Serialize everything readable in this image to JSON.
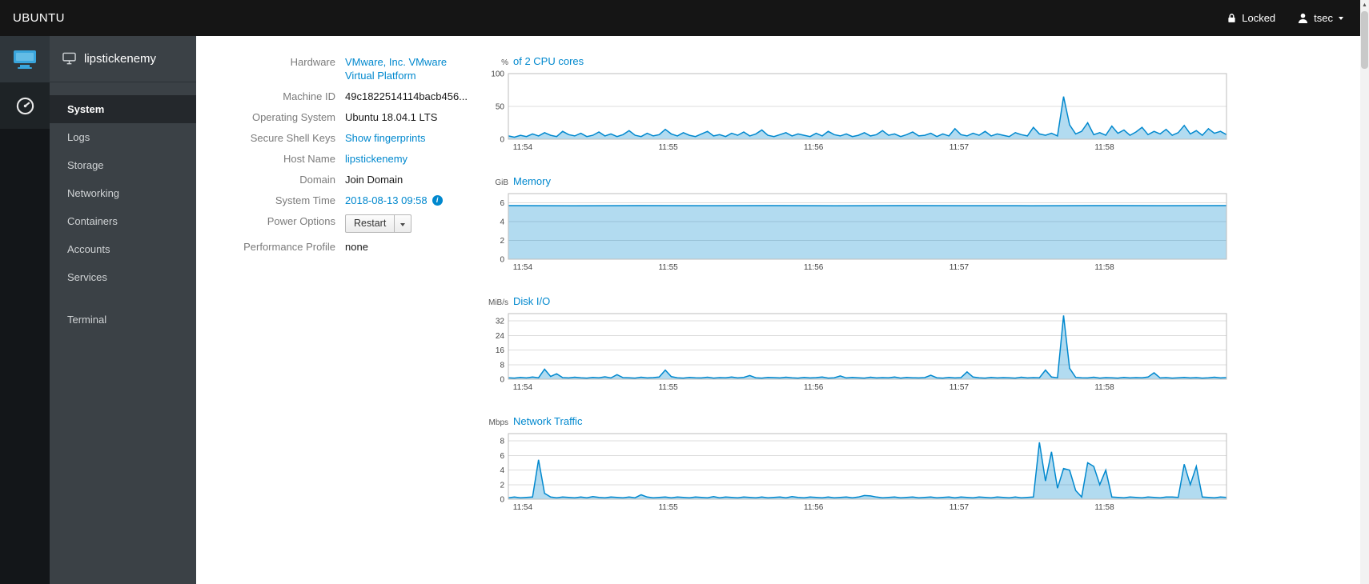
{
  "topbar": {
    "brand": "UBUNTU",
    "locked_label": "Locked",
    "user_label": "tsec"
  },
  "nav": {
    "host": "lipstickenemy",
    "items": [
      {
        "label": "System",
        "active": true
      },
      {
        "label": "Logs",
        "active": false
      },
      {
        "label": "Storage",
        "active": false
      },
      {
        "label": "Networking",
        "active": false
      },
      {
        "label": "Containers",
        "active": false
      },
      {
        "label": "Accounts",
        "active": false
      },
      {
        "label": "Services",
        "active": false
      }
    ],
    "secondary_items": [
      {
        "label": "Terminal",
        "active": false
      }
    ]
  },
  "details": {
    "rows": [
      {
        "label": "Hardware",
        "value": "VMware, Inc. VMware Virtual Platform",
        "type": "link"
      },
      {
        "label": "Machine ID",
        "value": "49c1822514114bacb456...",
        "type": "text"
      },
      {
        "label": "Operating System",
        "value": "Ubuntu 18.04.1 LTS",
        "type": "text"
      },
      {
        "label": "Secure Shell Keys",
        "value": "Show fingerprints",
        "type": "link"
      },
      {
        "label": "Host Name",
        "value": "lipstickenemy",
        "type": "link"
      },
      {
        "label": "Domain",
        "value": "Join Domain",
        "type": "action"
      },
      {
        "label": "System Time",
        "value": "2018-08-13 09:58",
        "type": "link",
        "info_icon": true
      },
      {
        "label": "Power Options",
        "value": "Restart",
        "type": "button_dropdown"
      },
      {
        "label": "Performance Profile",
        "value": "none",
        "type": "text"
      }
    ]
  },
  "chart_data": [
    {
      "type": "area",
      "unit": "%",
      "title": "of 2 CPU cores",
      "ylim": [
        0,
        100
      ],
      "yticks": [
        0,
        50,
        100
      ],
      "xtick_labels": [
        "11:54",
        "11:55",
        "11:56",
        "11:57",
        "11:58"
      ],
      "xtick_fracs": [
        0.02,
        0.2225,
        0.425,
        0.6275,
        0.83
      ],
      "values": [
        5,
        3,
        6,
        4,
        8,
        5,
        10,
        6,
        4,
        12,
        7,
        5,
        9,
        4,
        6,
        11,
        5,
        8,
        4,
        7,
        13,
        6,
        4,
        9,
        5,
        7,
        15,
        8,
        5,
        10,
        6,
        4,
        8,
        12,
        5,
        7,
        4,
        9,
        6,
        11,
        5,
        8,
        14,
        6,
        4,
        7,
        10,
        5,
        8,
        6,
        4,
        9,
        5,
        12,
        7,
        5,
        8,
        4,
        6,
        10,
        5,
        7,
        13,
        6,
        8,
        4,
        7,
        11,
        5,
        6,
        9,
        4,
        8,
        5,
        16,
        7,
        5,
        9,
        6,
        12,
        5,
        8,
        6,
        4,
        10,
        7,
        5,
        18,
        8,
        6,
        9,
        5,
        65,
        22,
        8,
        12,
        25,
        7,
        10,
        6,
        20,
        9,
        14,
        6,
        11,
        18,
        7,
        12,
        8,
        15,
        6,
        10,
        21,
        8,
        13,
        6,
        16,
        9,
        12,
        7
      ]
    },
    {
      "type": "area",
      "unit": "GiB",
      "title": "Memory",
      "ylim": [
        0,
        7
      ],
      "yticks": [
        0,
        2,
        4,
        6
      ],
      "xtick_labels": [
        "11:54",
        "11:55",
        "11:56",
        "11:57",
        "11:58"
      ],
      "xtick_fracs": [
        0.02,
        0.2225,
        0.425,
        0.6275,
        0.83
      ],
      "values": [
        5.72,
        5.7,
        5.72,
        5.71,
        5.72,
        5.7,
        5.72,
        5.71,
        5.7,
        5.72,
        5.71,
        5.72
      ]
    },
    {
      "type": "area",
      "unit": "MiB/s",
      "title": "Disk I/O",
      "ylim": [
        0,
        36
      ],
      "yticks": [
        0,
        8,
        16,
        24,
        32
      ],
      "xtick_labels": [
        "11:54",
        "11:55",
        "11:56",
        "11:57",
        "11:58"
      ],
      "xtick_fracs": [
        0.02,
        0.2225,
        0.425,
        0.6275,
        0.83
      ],
      "values": [
        0.8,
        0.6,
        1,
        0.7,
        1.2,
        0.8,
        5.5,
        1.5,
        3,
        0.9,
        0.7,
        1.1,
        0.8,
        0.6,
        1,
        0.8,
        1.3,
        0.7,
        2.5,
        0.9,
        0.8,
        0.6,
        1.1,
        0.7,
        0.9,
        1.2,
        5,
        1.4,
        0.8,
        0.6,
        1,
        0.8,
        0.7,
        1.1,
        0.6,
        0.9,
        0.8,
        1.2,
        0.7,
        1,
        2,
        0.8,
        0.6,
        1,
        0.9,
        0.7,
        1.1,
        0.8,
        0.6,
        1,
        0.7,
        0.9,
        1.2,
        0.6,
        0.8,
        1.8,
        0.7,
        1,
        0.8,
        0.6,
        1.1,
        0.7,
        0.9,
        0.8,
        1.2,
        0.6,
        1,
        0.8,
        0.7,
        0.9,
        2.2,
        0.8,
        0.6,
        1,
        0.7,
        0.9,
        4,
        1.2,
        0.8,
        0.6,
        1,
        0.7,
        0.9,
        0.8,
        0.6,
        1.1,
        0.7,
        0.9,
        0.8,
        5,
        1.2,
        0.8,
        35,
        6,
        1,
        0.8,
        0.7,
        1.1,
        0.6,
        0.9,
        0.8,
        0.6,
        1,
        0.7,
        0.9,
        0.8,
        1.2,
        3.5,
        0.7,
        0.9,
        0.6,
        0.8,
        1,
        0.7,
        0.9,
        0.6,
        0.8,
        1.1,
        0.7,
        0.9
      ]
    },
    {
      "type": "area",
      "unit": "Mbps",
      "title": "Network Traffic",
      "ylim": [
        0,
        9
      ],
      "yticks": [
        0,
        2,
        4,
        6,
        8
      ],
      "xtick_labels": [
        "11:54",
        "11:55",
        "11:56",
        "11:57",
        "11:58"
      ],
      "xtick_fracs": [
        0.02,
        0.2225,
        0.425,
        0.6275,
        0.83
      ],
      "values": [
        0.2,
        0.3,
        0.2,
        0.25,
        0.3,
        5.4,
        0.8,
        0.3,
        0.2,
        0.3,
        0.25,
        0.2,
        0.3,
        0.2,
        0.35,
        0.25,
        0.2,
        0.3,
        0.25,
        0.2,
        0.3,
        0.2,
        0.6,
        0.3,
        0.2,
        0.25,
        0.3,
        0.2,
        0.3,
        0.25,
        0.2,
        0.3,
        0.25,
        0.2,
        0.35,
        0.2,
        0.3,
        0.25,
        0.2,
        0.3,
        0.25,
        0.2,
        0.3,
        0.2,
        0.25,
        0.3,
        0.2,
        0.35,
        0.25,
        0.2,
        0.3,
        0.25,
        0.2,
        0.3,
        0.2,
        0.25,
        0.3,
        0.2,
        0.3,
        0.5,
        0.45,
        0.3,
        0.2,
        0.25,
        0.3,
        0.2,
        0.25,
        0.3,
        0.2,
        0.25,
        0.3,
        0.2,
        0.25,
        0.3,
        0.2,
        0.3,
        0.25,
        0.2,
        0.3,
        0.25,
        0.2,
        0.3,
        0.25,
        0.2,
        0.3,
        0.2,
        0.25,
        0.3,
        7.8,
        2.5,
        6.5,
        1.5,
        4.2,
        4,
        1.2,
        0.3,
        5,
        4.5,
        2,
        4,
        0.3,
        0.25,
        0.2,
        0.3,
        0.25,
        0.2,
        0.3,
        0.25,
        0.2,
        0.3,
        0.3,
        0.25,
        4.8,
        2,
        4.5,
        0.3,
        0.25,
        0.2,
        0.3,
        0.25
      ]
    }
  ]
}
